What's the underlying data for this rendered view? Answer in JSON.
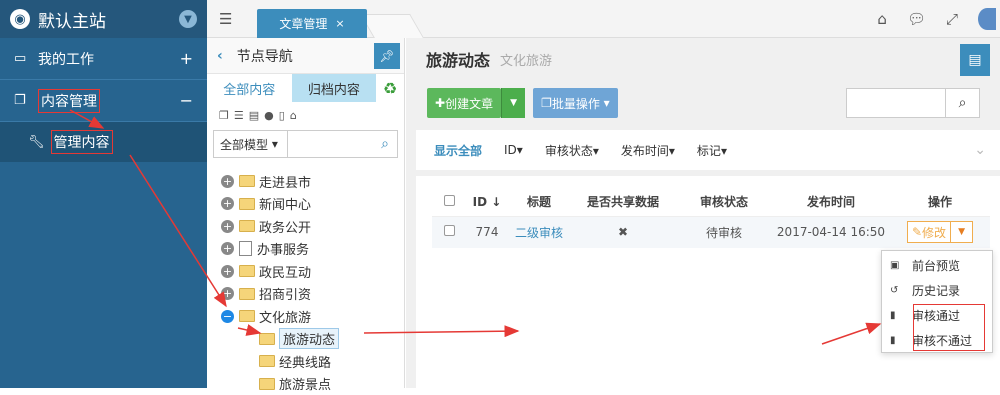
{
  "sidebar": {
    "brand": "默认主站",
    "items": [
      {
        "label": "我的工作",
        "toggle": "+"
      },
      {
        "label": "内容管理",
        "toggle": "−"
      }
    ],
    "sub_item": "管理内容"
  },
  "topbar": {
    "active_tab": "文章管理",
    "close": "×"
  },
  "node_panel": {
    "title": "节点导航",
    "tabs": [
      "全部内容",
      "归档内容"
    ],
    "model_select": "全部模型",
    "tree": [
      {
        "label": "走进县市"
      },
      {
        "label": "新闻中心"
      },
      {
        "label": "政务公开"
      },
      {
        "label": "办事服务"
      },
      {
        "label": "政民互动"
      },
      {
        "label": "招商引资"
      },
      {
        "label": "文化旅游"
      }
    ],
    "children": [
      "旅游动态",
      "经典线路",
      "旅游景点"
    ]
  },
  "main": {
    "title": "旅游动态",
    "subtitle": "文化旅游",
    "create_btn": "创建文章",
    "batch_btn": "批量操作",
    "filters": [
      "显示全部",
      "ID",
      "审核状态",
      "发布时间",
      "标记"
    ],
    "columns": [
      "ID",
      "标题",
      "是否共享数据",
      "审核状态",
      "发布时间",
      "操作"
    ],
    "rows": [
      {
        "id": "774",
        "title": "二级审核",
        "shared": "✖",
        "status": "待审核",
        "time": "2017-04-14 16:50",
        "action": "修改"
      }
    ],
    "dropdown": [
      "前台预览",
      "历史记录",
      "审核通过",
      "审核不通过"
    ]
  }
}
